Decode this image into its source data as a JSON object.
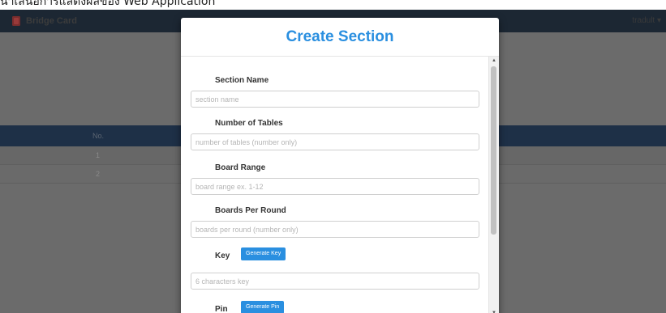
{
  "caption": "นำเสนอการแสดงผลของ Web Application",
  "navbar": {
    "brand": "Bridge Card",
    "user": "tradult ▾"
  },
  "table": {
    "header_no": "No.",
    "rows": [
      "1",
      "2"
    ]
  },
  "modal": {
    "title": "Create Section",
    "fields": {
      "section_name": {
        "label": "Section Name",
        "placeholder": "section name"
      },
      "num_tables": {
        "label": "Number of Tables",
        "placeholder": "number of tables (number only)"
      },
      "board_range": {
        "label": "Board Range",
        "placeholder": "board range ex. 1-12"
      },
      "boards_per_round": {
        "label": "Boards Per Round",
        "placeholder": "boards per round (number only)"
      },
      "key": {
        "label": "Key",
        "button": "Generate Key",
        "placeholder": "6 characters key"
      },
      "pin": {
        "label": "Pin",
        "button": "Generate Pin"
      }
    }
  },
  "colors": {
    "accent": "#2a8fe0",
    "navbar": "#1c2733",
    "overlay": "#6b6b6b"
  },
  "icons": {
    "brand": "card-icon",
    "scroll_up": "scroll-up-arrow-icon",
    "scroll_down": "scroll-down-arrow-icon"
  }
}
